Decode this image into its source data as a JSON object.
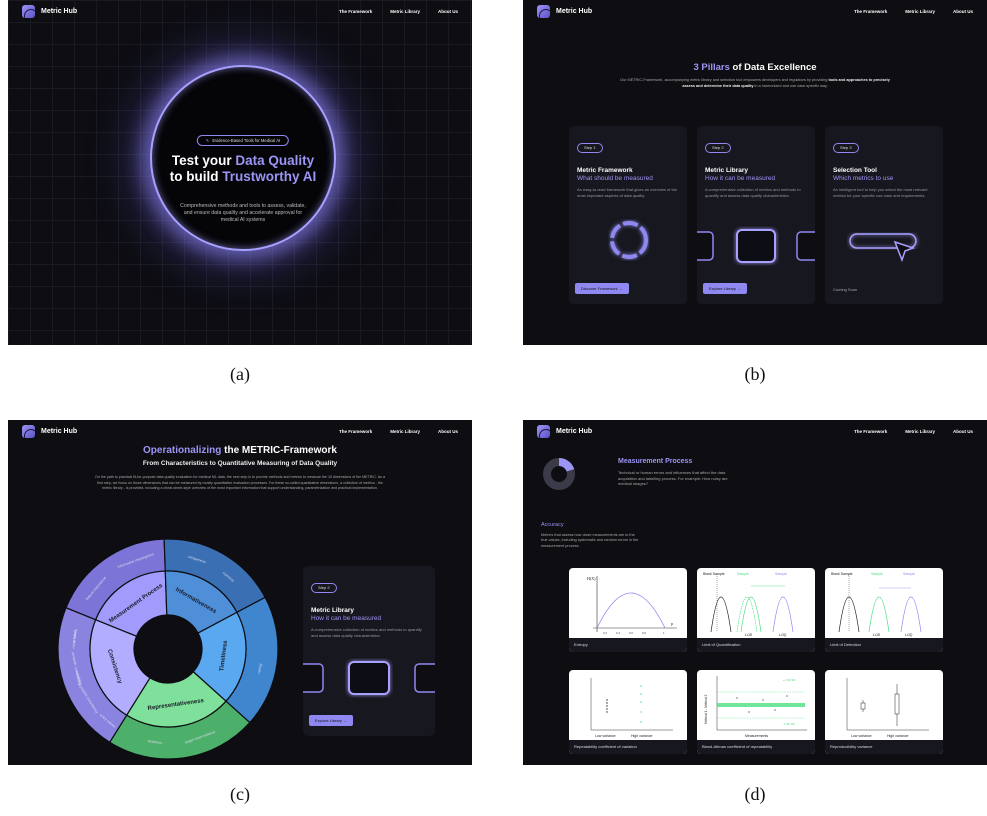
{
  "nav": {
    "brand": "Metric Hub",
    "links": [
      "The Framework",
      "Metric Library",
      "About Us"
    ]
  },
  "captions": [
    "(a)",
    "(b)",
    "(c)",
    "(d)"
  ],
  "panel_a": {
    "pill": "Evidence-Based Tools for Medical AI",
    "title_line1_pre": "Test your ",
    "title_line1_accent": "Data Quality",
    "title_line2_pre": "to build ",
    "title_line2_accent": "Trustworthy AI",
    "subtitle": "Comprehensive methods and tools to assess, validate, and ensure data quality and accelerate approval for medical AI systems"
  },
  "panel_b": {
    "title_accent": "3 Pillars",
    "title_rest": " of Data Excellence",
    "desc_pre": "Our METRIC-Framework, accompanying metric library and selection tool empowers developers and regulators by providing ",
    "desc_bold": "tools and approaches to precisely assess and determine their data quality",
    "desc_post": " in a harmonized and use case-specific way.",
    "cards": [
      {
        "step": "Step 1",
        "title": "Metric Framework",
        "subtitle": "What should be measured",
        "desc": "An easy-to-read framework that gives an overview of the most important aspects of data quality.",
        "button": "Discover Framework →"
      },
      {
        "step": "Step 2",
        "title": "Metric Library",
        "subtitle": "How it can be measured",
        "desc": "A comprehensive collection of metrics and methods to quantify and assess data quality characteristics.",
        "button": "Explore Library →"
      },
      {
        "step": "Step 3",
        "title": "Selection Tool",
        "subtitle": "Which metrics to use",
        "desc": "An intelligent tool to help you select the most relevant metrics for your specific use case and requirements.",
        "button": "Coming Soon"
      }
    ]
  },
  "panel_c": {
    "title_accent": "Operationalizing",
    "title_rest": " the METRIC-Framework",
    "subtitle": "From Characteristics to Quantitative Measuring of Data Quality",
    "desc": "On the path to practical fit-for-purpose data quality evaluation for medical ML data, the next step is to provide methods and metrics to measure the 15 dimensions of the METRIC. As a first step, we focus on those dimensions that can be measured by mostly quantitative evaluation processes. For these so-called quantitative dimensions, a collection of metrics - the metric library - is provided, including a cheat-sheet-style overview of the most important information that support understanding, parametrization and practical implementation.",
    "wheel": {
      "inner": [
        "Measurement Process",
        "Informativeness",
        "Timeliness",
        "Representativeness",
        "Consistency"
      ],
      "outer": [
        "feature importance",
        "informative missingness",
        "uniqueness",
        "currency",
        "variety",
        "target class balance",
        "depiction",
        "syntactic consistency",
        "semantic consistency",
        "noisy labels",
        "entry values",
        "accuracy",
        "reliability"
      ]
    },
    "card": {
      "step": "Step 2",
      "title": "Metric Library",
      "subtitle": "How it can be measured",
      "desc": "A comprehensive collection of metrics and methods to quantify and assess data quality characteristics.",
      "button": "Explore Library →"
    }
  },
  "panel_d": {
    "section_title": "Measurement Process",
    "section_desc": "Technical or human errors and influences that affect the data acquisition and labelling process. For example: How noisy are medical images?",
    "subsection_title": "Accuracy",
    "subsection_desc": "Metrics that assess how close measurements are to the true values, including systematic and random errors in the measurement process.",
    "tiles": [
      {
        "label": "Entropy"
      },
      {
        "label": "Limit of Quantification"
      },
      {
        "label": "Limit of Detection"
      },
      {
        "label": "Repeatability coefficient of variation"
      },
      {
        "label": "Bland-Altman coefficient of repeatability"
      },
      {
        "label": "Reproducibility variance"
      }
    ],
    "plot_text": {
      "hx": "H(X)",
      "p": "p",
      "blank": "Blank Sample",
      "sample": "Sample",
      "lod_lbl": "LOD",
      "loq_lbl": "LOQ",
      "low_var": "Low variance",
      "high_var": "High variance",
      "measurements": "Measurements",
      "method_diff": "Method 1 - Method 2",
      "ba_upper": "+1.96 SD",
      "ba_lower": "-1.96 SD",
      "ent_ticks": [
        "0.2",
        "0.4",
        "0.6",
        "0.8",
        "1"
      ]
    }
  },
  "colors": {
    "accent": "#9d95f5",
    "bg": "#0d0d12",
    "card": "#17171f",
    "green": "#4ade80",
    "blue": "#60a5fa"
  }
}
